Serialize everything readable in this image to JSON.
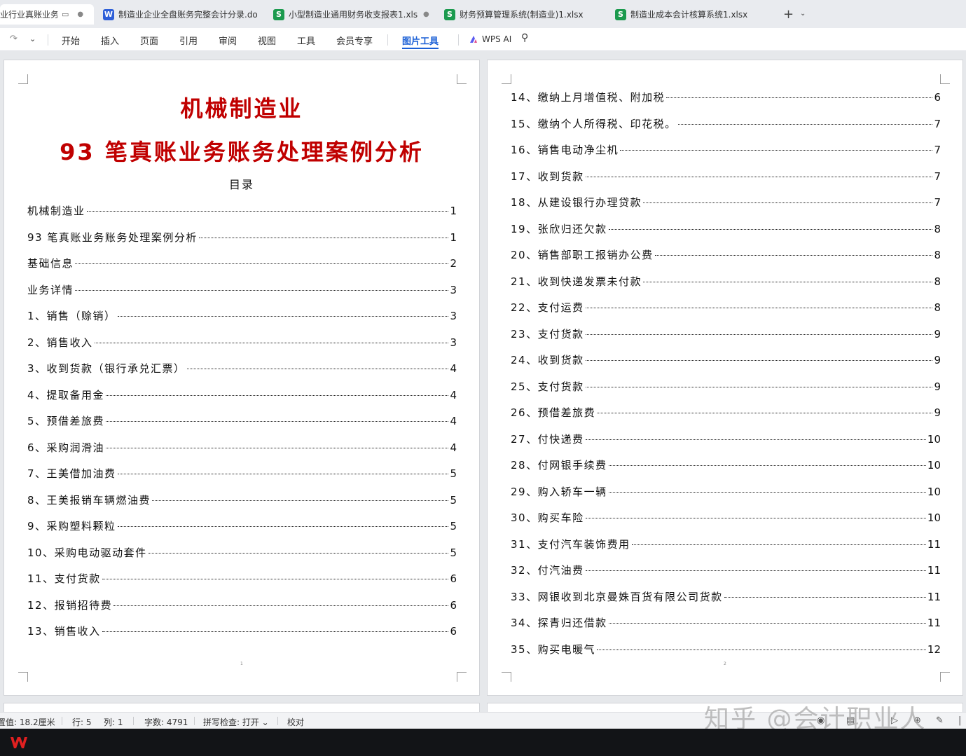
{
  "tabs": [
    {
      "label": "业行业真账业务",
      "type": "doc-truncated",
      "active": true
    },
    {
      "label": "制造业企业全盘账务完整会计分录.do",
      "icon": "W",
      "type": "doc"
    },
    {
      "label": "小型制造业通用财务收支报表1.xls",
      "icon": "S",
      "type": "sheet"
    },
    {
      "label": "财务预算管理系统(制造业)1.xlsx",
      "icon": "S",
      "type": "sheet"
    },
    {
      "label": "制造业成本会计核算系统1.xlsx",
      "icon": "S",
      "type": "sheet"
    }
  ],
  "toolbar": {
    "new_tab": "+",
    "menus": [
      "开始",
      "插入",
      "页面",
      "引用",
      "审阅",
      "视图",
      "工具",
      "会员专享"
    ],
    "active_menu": "图片工具",
    "wps_ai": "WPS AI"
  },
  "page1": {
    "title_line1": "机械制造业",
    "title_line2": "93 笔真账业务账务处理案例分析",
    "toc_heading": "目录",
    "page_num": "1",
    "toc": [
      {
        "label": "机械制造业",
        "page": "1"
      },
      {
        "label": "93 笔真账业务账务处理案例分析",
        "page": "1"
      },
      {
        "label": "基础信息",
        "page": "2"
      },
      {
        "label": "业务详情",
        "page": "3"
      },
      {
        "label": "1、销售（赊销）",
        "page": "3"
      },
      {
        "label": "2、销售收入",
        "page": "3"
      },
      {
        "label": "3、收到货款（银行承兑汇票）",
        "page": "4"
      },
      {
        "label": "4、提取备用金",
        "page": "4"
      },
      {
        "label": "5、预借差旅费",
        "page": "4"
      },
      {
        "label": "6、采购润滑油",
        "page": "4"
      },
      {
        "label": "7、王美借加油费",
        "page": "5"
      },
      {
        "label": "8、王美报销车辆燃油费",
        "page": "5"
      },
      {
        "label": "9、采购塑料颗粒",
        "page": "5"
      },
      {
        "label": "10、采购电动驱动套件",
        "page": "5"
      },
      {
        "label": "11、支付货款",
        "page": "6"
      },
      {
        "label": "12、报销招待费",
        "page": "6"
      },
      {
        "label": "13、销售收入",
        "page": "6"
      }
    ]
  },
  "page2": {
    "page_num": "2",
    "toc": [
      {
        "label": "14、缴纳上月增值税、附加税",
        "page": "6"
      },
      {
        "label": "15、缴纳个人所得税、印花税。",
        "page": "7"
      },
      {
        "label": "16、销售电动净尘机",
        "page": "7"
      },
      {
        "label": "17、收到货款",
        "page": "7"
      },
      {
        "label": "18、从建设银行办理贷款",
        "page": "7"
      },
      {
        "label": "19、张欣归还欠款",
        "page": "8"
      },
      {
        "label": "20、销售部职工报销办公费",
        "page": "8"
      },
      {
        "label": "21、收到快递发票未付款",
        "page": "8"
      },
      {
        "label": "22、支付运费",
        "page": "8"
      },
      {
        "label": "23、支付货款",
        "page": "9"
      },
      {
        "label": "24、收到货款",
        "page": "9"
      },
      {
        "label": "25、支付货款",
        "page": "9"
      },
      {
        "label": "26、预借差旅费",
        "page": "9"
      },
      {
        "label": "27、付快递费",
        "page": "10"
      },
      {
        "label": "28、付网银手续费",
        "page": "10"
      },
      {
        "label": "29、购入轿车一辆",
        "page": "10"
      },
      {
        "label": "30、购买车险",
        "page": "10"
      },
      {
        "label": "31、支付汽车装饰费用",
        "page": "11"
      },
      {
        "label": "32、付汽油费",
        "page": "11"
      },
      {
        "label": "33、网银收到北京曼姝百货有限公司货款",
        "page": "11"
      },
      {
        "label": "34、探青归还借款",
        "page": "11"
      },
      {
        "label": "35、购买电暖气",
        "page": "12"
      }
    ]
  },
  "statusbar": {
    "setting": "置值: 18.2厘米",
    "row": "行: 5",
    "col": "列: 1",
    "word_count": "字数: 4791",
    "spell_check": "拼写检查: 打开 ⌄",
    "proofread": "校对"
  },
  "watermark": "知乎 @会计职业人",
  "colors": {
    "title_red": "#c00000",
    "active_blue": "#1a5fd6",
    "wps_red": "#e02020"
  }
}
